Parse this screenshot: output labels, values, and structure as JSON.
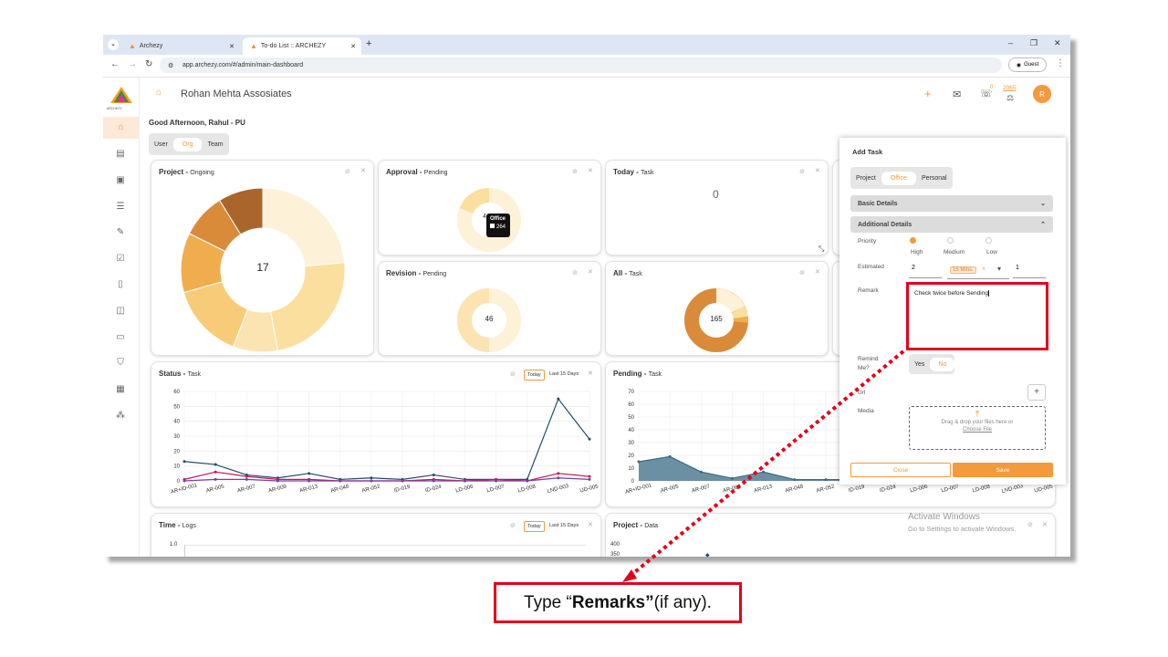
{
  "browser": {
    "tabs": [
      {
        "title": "Archezy"
      },
      {
        "title": "To-do List :: ARCHEZY"
      }
    ],
    "url": "app.archezy.com/#/admin/main-dashboard",
    "profile": "Guest"
  },
  "app": {
    "logo_text": "ARCHEZY",
    "company": "Rohan Mehta Assosiates",
    "greeting": "Good Afternoon, Rahul - PU",
    "scope_tabs": [
      "User",
      "Org",
      "Team"
    ],
    "scope_selected": "Org",
    "header": {
      "plus": "+",
      "notifications_count": "0",
      "points": "2065",
      "avatar_initial": "R"
    }
  },
  "cards": {
    "project": {
      "title": "Project -",
      "sub": "Ongoing",
      "center": "17"
    },
    "approval": {
      "title": "Approval -",
      "sub": "Pending",
      "tooltip_title": "Office",
      "tooltip_value": "264",
      "partial": "4"
    },
    "today": {
      "title": "Today -",
      "sub": "Task",
      "value": "0"
    },
    "revision": {
      "title": "Revision -",
      "sub": "Pending",
      "center": "46"
    },
    "all": {
      "title": "All -",
      "sub": "Task",
      "center": "165"
    },
    "status": {
      "title": "Status -",
      "sub": "Task",
      "btn_today": "Today",
      "btn_last": "Last 15 Days"
    },
    "pending": {
      "title": "Pending -",
      "sub": "Task"
    },
    "time": {
      "title": "Time -",
      "sub": "Logs",
      "btn_today": "Today",
      "btn_last": "Last 15 Days",
      "y_top": "1.0"
    },
    "projectdata": {
      "title": "Project -",
      "sub": "Data",
      "y1": "400",
      "y2": "350"
    }
  },
  "chart_data": [
    {
      "type": "line",
      "title": "Status - Task",
      "categories": [
        "AR+ID-001",
        "AR-005",
        "AR-007",
        "AR-009",
        "AR-013",
        "AR-048",
        "AR-052",
        "ID-019",
        "ID-024",
        "LD-006",
        "LD-007",
        "LD-008",
        "LND-003",
        "UD-005"
      ],
      "ylim": [
        0,
        60
      ],
      "yticks": [
        "60",
        "50",
        "40",
        "30",
        "20",
        "10",
        "0"
      ],
      "series": [
        {
          "color": "#1f4e6b",
          "values": [
            13,
            11,
            4,
            2,
            5,
            1,
            2,
            1,
            4,
            1,
            1,
            1,
            55,
            28
          ]
        },
        {
          "color": "#c2185b",
          "values": [
            1,
            6,
            3,
            1,
            1,
            0,
            0,
            0,
            1,
            0,
            1,
            0,
            5,
            3
          ]
        },
        {
          "color": "#7b3fa0",
          "values": [
            0,
            1,
            1,
            0,
            0,
            0,
            0,
            0,
            0,
            0,
            0,
            0,
            2,
            1
          ]
        }
      ]
    },
    {
      "type": "area",
      "title": "Pending - Task",
      "categories": [
        "AR+ID-001",
        "AR-005",
        "AR-007",
        "AR-009",
        "AR-013",
        "AR-048",
        "AR-052",
        "ID-019",
        "ID-024",
        "LD-006",
        "LD-007",
        "LD-008",
        "LND-003",
        "UD-005"
      ],
      "ylim": [
        0,
        70
      ],
      "yticks": [
        "70",
        "60",
        "50",
        "40",
        "30",
        "20",
        "10",
        "0"
      ],
      "series": [
        {
          "color": "#3b6b84",
          "values": [
            15,
            19,
            7,
            2,
            7,
            1,
            1,
            1
          ]
        }
      ]
    },
    {
      "type": "pie",
      "title": "Project - Ongoing",
      "center_value": "17",
      "colors": [
        "#fdf1d8",
        "#fbdf9e",
        "#fbe4b2",
        "#f8cb78",
        "#f0ad4e",
        "#d98b3a",
        "#a9652a"
      ],
      "values": [
        4,
        4,
        1.5,
        2.5,
        2,
        1.5,
        1.5
      ]
    }
  ],
  "add_task": {
    "title": "Add Task",
    "type_tabs": [
      "Project",
      "Office",
      "Personal"
    ],
    "type_selected": "Office",
    "basic_details": "Basic Details",
    "additional_details": "Additional Details",
    "priority_label": "Priority",
    "priority_options": [
      "High",
      "Medium",
      "Low"
    ],
    "estimated_label": "Estimated",
    "estimated_value": "2",
    "estimated_unit": "15 Mins.",
    "estimated_count": "1",
    "remark_label": "Remark",
    "remark_value": "Check twice before Sending",
    "remind_label": "Remind Me?",
    "remind_yes": "Yes",
    "remind_no": "No",
    "url_label": "Url",
    "media_label": "Media",
    "drop_text": "Drag & drop your files here or",
    "choose_file": "Choose File",
    "close": "Close",
    "save": "Save"
  },
  "watermark": {
    "line1": "Activate Windows",
    "line2": "Go to Settings to activate Windows."
  },
  "callout": {
    "prefix": "Type “",
    "bold": "Remarks”",
    "suffix": " (if any)."
  },
  "colors": {
    "accent": "#f39a3d",
    "highlight": "#e3001b"
  }
}
